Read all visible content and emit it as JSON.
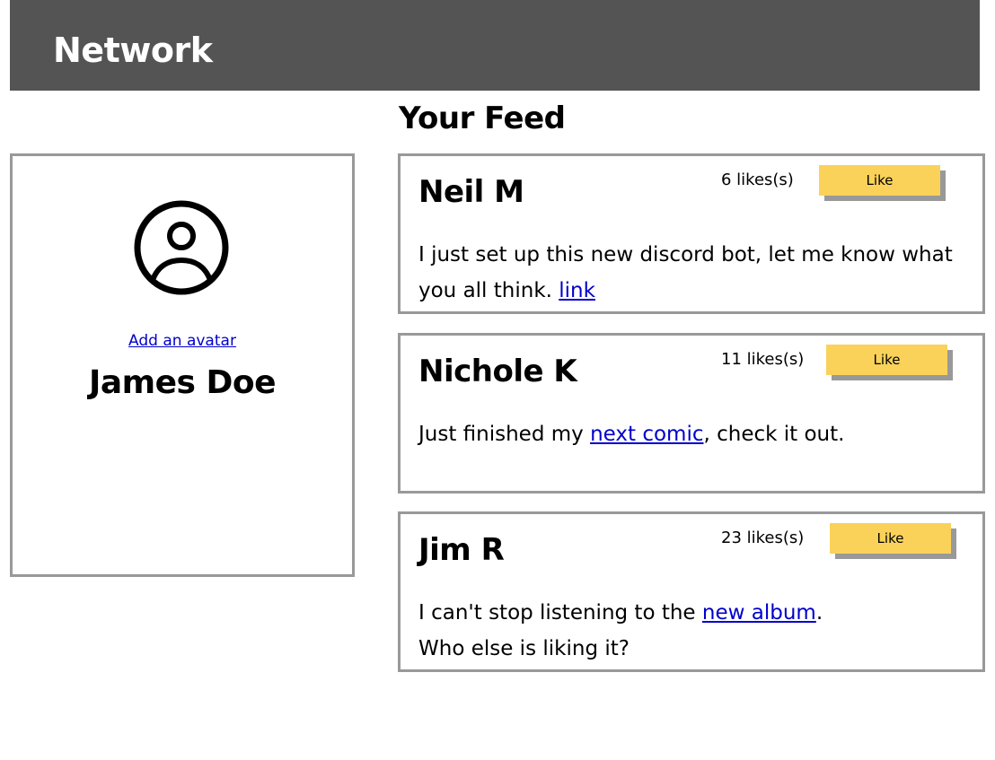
{
  "header": {
    "title": "Network"
  },
  "feed": {
    "heading": "Your Feed"
  },
  "profile": {
    "add_avatar_label": "Add an avatar",
    "name": "James Doe",
    "avatar_icon": "user-circle-icon"
  },
  "colors": {
    "header_bg": "#545454",
    "like_button": "#fad25a",
    "border": "#999999",
    "link": "#0000cc"
  },
  "posts": [
    {
      "author": "Neil M",
      "likes": "6 likes(s)",
      "like_label": "Like",
      "text_before": "I just set up this new discord bot, let me know what you all think. ",
      "link_text": "link",
      "text_after": ""
    },
    {
      "author": "Nichole K",
      "likes": "11 likes(s)",
      "like_label": "Like",
      "text_before": "Just finished my ",
      "link_text": "next comic",
      "text_after": ", check it out."
    },
    {
      "author": "Jim R",
      "likes": "23 likes(s)",
      "like_label": "Like",
      "text_before": "I can't stop listening to the ",
      "link_text": "new album",
      "text_after": ".",
      "text_line2": "Who else is liking it?"
    }
  ]
}
